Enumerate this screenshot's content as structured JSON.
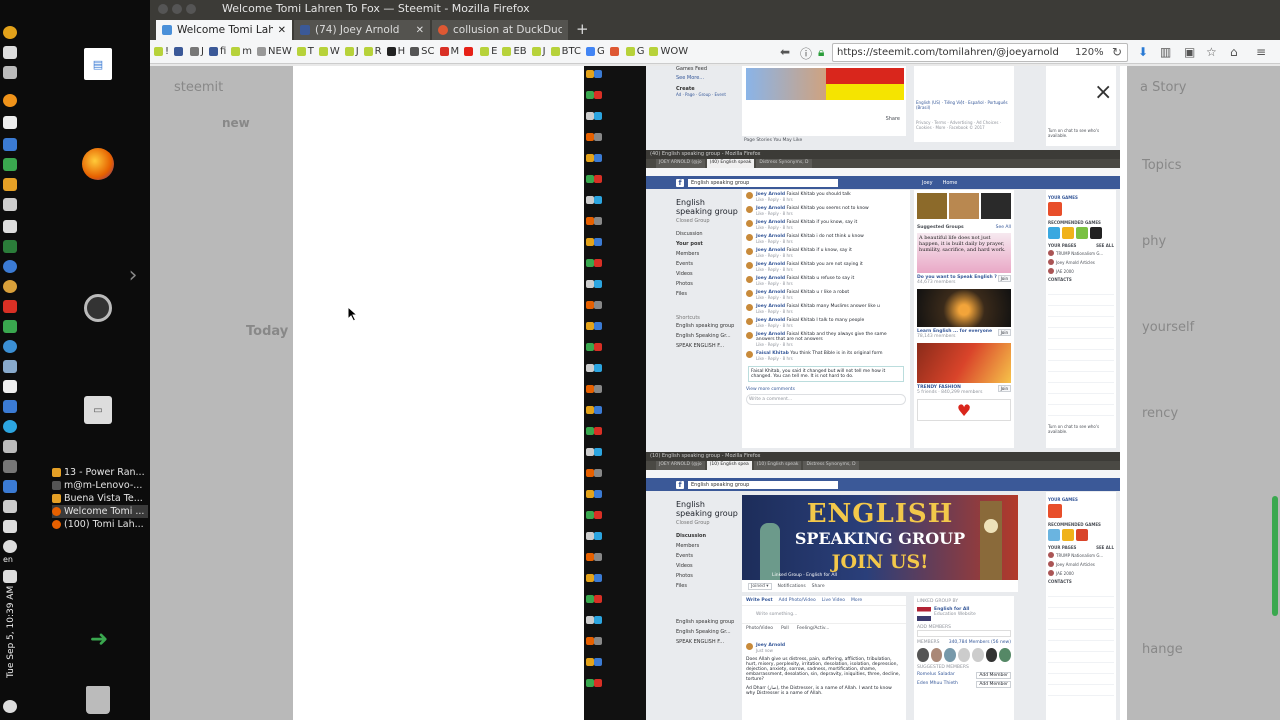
{
  "window": {
    "title": "Welcome Tomi Lahren To Fox — Steemit - Mozilla Firefox"
  },
  "tabs": [
    {
      "label": "Welcome Tomi Lahren",
      "active": true,
      "color": "#4a90d9"
    },
    {
      "label": "(74) Joey Arnold",
      "active": false,
      "color": "#3b5998"
    },
    {
      "label": "collusion at DuckDuck",
      "active": false,
      "color": "#de5833"
    }
  ],
  "new_tab": "+",
  "bookmarks": [
    {
      "label": "!",
      "color": "#b7d23a"
    },
    {
      "label": "",
      "color": "#3b5998"
    },
    {
      "label": "J",
      "color": "#777"
    },
    {
      "label": "fi",
      "color": "#3b5998"
    },
    {
      "label": "m",
      "color": "#b7d23a"
    },
    {
      "label": "NEW",
      "color": "#999"
    },
    {
      "label": "T",
      "color": "#b7d23a"
    },
    {
      "label": "W",
      "color": "#b7d23a"
    },
    {
      "label": "J",
      "color": "#b7d23a"
    },
    {
      "label": "R",
      "color": "#b7d23a"
    },
    {
      "label": "H",
      "color": "#222"
    },
    {
      "label": "SC",
      "color": "#555"
    },
    {
      "label": "M",
      "color": "#d93025"
    },
    {
      "label": "",
      "color": "#e62117"
    },
    {
      "label": "E",
      "color": "#b7d23a"
    },
    {
      "label": "EB",
      "color": "#b7d23a"
    },
    {
      "label": "J",
      "color": "#b7d23a"
    },
    {
      "label": "BTC",
      "color": "#b7d23a"
    },
    {
      "label": "G",
      "color": "#4285f4"
    },
    {
      "label": "",
      "color": "#de5833"
    },
    {
      "label": "G",
      "color": "#b7d23a"
    },
    {
      "label": "WOW",
      "color": "#b7d23a"
    }
  ],
  "url": "https://steemit.com/tomilahren/@joeyarnold",
  "zoom": "120%",
  "task_list": [
    {
      "label": "13 - Power Ran...",
      "color": "#e5a026"
    },
    {
      "label": "m@m-Lenovo-...",
      "color": "#333"
    },
    {
      "label": "Buena Vista Te...",
      "color": "#e5a026"
    },
    {
      "label": "Welcome Tomi ...",
      "color": "#e66000",
      "active": true
    },
    {
      "label": "(100) Tomi Lah...",
      "color": "#e66000"
    }
  ],
  "clock": "Tue Sep 5, 10:39 AM",
  "keyboard": "en",
  "steemit_ghost": {
    "logo": "steemit",
    "story": "a Story",
    "topics": "Topics",
    "new": "new",
    "today": "Today",
    "phy": "phy",
    "yourself": "yourself",
    "rency": "rency",
    "hange": "hange"
  },
  "close": "×",
  "fb_top": {
    "games_feed": "Games Feed",
    "see_more": "See More...",
    "create": "Create",
    "create_links": "Ad · Page · Group · Event",
    "page_stories": "Page Stories You May Like",
    "share": "Share",
    "lang": "English (US) · Tiếng Việt · Español · Português (Brasil)",
    "footer": "Privacy · Terms · Advertising · Ad Choices · Cookies · More · Facebook © 2017",
    "chat": "Turn on chat to see who's available."
  },
  "fb1": {
    "window_title": "(40) English speaking group - Mozilla Firefox",
    "tabs": [
      "JOEY ARNOLD (@jo",
      "(40) English speak",
      "Distress Synonyms, D"
    ],
    "search": "English speaking group",
    "user": "Joey",
    "home": "Home",
    "group_name": "English speaking group",
    "group_type": "Closed Group",
    "nav": [
      "Discussion",
      "Your post",
      "Members",
      "Events",
      "Videos",
      "Photos",
      "Files"
    ],
    "shortcuts_head": "Shortcuts",
    "shortcuts": [
      "English speaking group",
      "English Speaking Gr...",
      "SPEAK ENGLISH F..."
    ],
    "comments": [
      {
        "name": "Joey Arnold",
        "text": "Faisal Khitab you should talk"
      },
      {
        "name": "Joey Arnold",
        "text": "Faisal Khitab you seems not to know"
      },
      {
        "name": "Joey Arnold",
        "text": "Faisal Khitab if you know, say it"
      },
      {
        "name": "Joey Arnold",
        "text": "Faisal Khitab i do not think u know"
      },
      {
        "name": "Joey Arnold",
        "text": "Faisal Khitab if u know, say it"
      },
      {
        "name": "Joey Arnold",
        "text": "Faisal Khitab you are not saying it"
      },
      {
        "name": "Joey Arnold",
        "text": "Faisal Khitab u refuse to say it"
      },
      {
        "name": "Joey Arnold",
        "text": "Faisal Khitab u r like a robot"
      },
      {
        "name": "Joey Arnold",
        "text": "Faisal Khitab many Muslims answer like u"
      },
      {
        "name": "Joey Arnold",
        "text": "Faisal Khitab I talk to many people"
      },
      {
        "name": "Joey Arnold",
        "text": "Faisal Khitab and they always give the same answers that are not answers"
      },
      {
        "name": "Faisal Khitab",
        "text": "You think That Bible is in its original form"
      }
    ],
    "reply_meta": "Like · Reply · 8 hrs",
    "reply_draft": "Faisal Khitab, you said it changed but will not tell me how it changed. You can tell me. It is not hard to do.",
    "view_more": "View more comments",
    "write_comment": "Write a comment...",
    "suggested_head": "Suggested Groups",
    "see_all": "See All",
    "quote": "A beautiful life does not just happen, it is built daily by prayer, humility, sacrifice, and hard work.",
    "group1": "Do you want to Speak English ?",
    "group1_members": "44,673 members",
    "group2": "Learn English ... for everyone",
    "group2_members": "78,143 members",
    "group3": "TRENDY FASHION",
    "group3_members": "5 friends · 840,299 members",
    "join": "Join",
    "side_games": "YOUR GAMES",
    "side_recommended": "RECOMMENDED GAMES",
    "side_pages": "YOUR PAGES",
    "side_pages_see_all": "SEE ALL",
    "pages": [
      "TRUMP Nationalism G...",
      "Joey Arnold Articles",
      "JAE 2000"
    ],
    "side_contacts": "CONTACTS",
    "chat": "Turn on chat to see who's available."
  },
  "fb2": {
    "window_title": "(10) English speaking group - Mozilla Firefox",
    "tabs": [
      "JOEY ARNOLD (@jo",
      "(10) English spea",
      "(10) English speak",
      "Distress Synonyms, D"
    ],
    "search": "English speaking group",
    "group_name": "English speaking group",
    "group_type": "Closed Group",
    "nav": [
      "Discussion",
      "Members",
      "Events",
      "Videos",
      "Photos",
      "Files"
    ],
    "shortcuts": [
      "English speaking group",
      "English Speaking Gr...",
      "SPEAK ENGLISH F..."
    ],
    "banner_line1": "ENGLISH",
    "banner_line2": "SPEAKING GROUP",
    "banner_line3": "JOIN US!",
    "linked": "Linked Group · English for All",
    "joined": "Joined ▾",
    "notifications": "Notifications",
    "share": "Share",
    "write_post": "Write Post",
    "add_photo": "Add Photo/Video",
    "live_video": "Live Video",
    "more": "More",
    "write_something": "Write something...",
    "photo_video": "Photo/Video",
    "poll": "Poll",
    "feeling": "Feeling/Activ...",
    "post_author": "Joey Arnold",
    "post_time": "Just now",
    "post_text": "Does Allah give us distress, pain, suffering, affliction, tribulation, hurt, misery, perplexity, irritation, desolation, isolation, depression, dejection, anxiety, sorrow, sadness, mortification, shame, embarrassment, desolation, sin, depravity, iniquities, three, decline, torture?",
    "post_text2": "Ad Dharr (ضار), the Distresser, is a name of Allah. I want to know why Distresser is a name of Allah.",
    "linked_head": "LINKED GROUP BY",
    "linked_name": "English for All",
    "linked_sub": "Education Website",
    "add_members": "ADD MEMBERS",
    "members_head": "MEMBERS",
    "members_count": "340,784 Members (56 new)",
    "suggested_members": "SUGGESTED MEMBERS",
    "suggested": [
      "Romelus Saladar",
      "Eden Mhuu Thieth"
    ],
    "add_member": "Add Member"
  }
}
